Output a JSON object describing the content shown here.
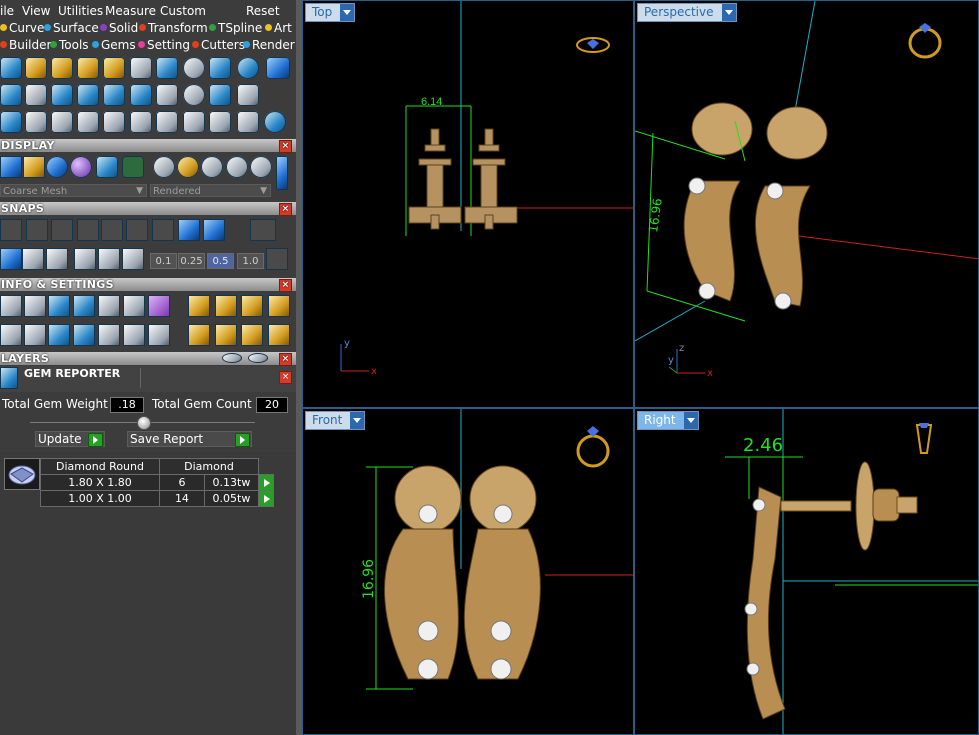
{
  "menu": [
    "ile",
    "View",
    "Utilities",
    "Measure",
    "Custom",
    "Reset"
  ],
  "tabs_row1": [
    {
      "label": "Curve",
      "color": "#f0c020"
    },
    {
      "label": "Surface",
      "color": "#2ea0e0"
    },
    {
      "label": "Solid",
      "color": "#8a40c0"
    },
    {
      "label": "Transform",
      "color": "#e04020"
    },
    {
      "label": "TSpline",
      "color": "#30a040"
    },
    {
      "label": "Art",
      "color": "#f0c020"
    }
  ],
  "tabs_row2": [
    {
      "label": "Builder",
      "color": "#e04020"
    },
    {
      "label": "Tools",
      "color": "#30a040"
    },
    {
      "label": "Gems",
      "color": "#2ea0e0"
    },
    {
      "label": "Setting",
      "color": "#e040a0"
    },
    {
      "label": "Cutters",
      "color": "#e04020"
    },
    {
      "label": "Render",
      "color": "#2ea0e0"
    }
  ],
  "sections": {
    "display": "DISPLAY",
    "snaps": "SNAPS",
    "info": "INFO & SETTINGS",
    "layers": "LAYERS",
    "gem_reporter": "GEM REPORTER"
  },
  "display": {
    "mesh_mode": "Coarse Mesh",
    "render_mode": "Rendered"
  },
  "snaps": {
    "steps": [
      "0.1",
      "0.25",
      "0.5",
      "1.0"
    ],
    "selected": "0.5"
  },
  "gem_reporter": {
    "total_weight_label": "Total Gem Weight",
    "total_weight": ".18",
    "total_count_label": "Total Gem Count",
    "total_count": "20",
    "update_label": "Update",
    "save_label": "Save Report",
    "table_headers": [
      "Diamond Round",
      "Diamond"
    ],
    "rows": [
      {
        "size": "1.80 X 1.80",
        "count": "6",
        "weight": "0.13tw"
      },
      {
        "size": "1.00 X 1.00",
        "count": "14",
        "weight": "0.05tw"
      }
    ]
  },
  "viewports": {
    "top": {
      "label": "Top",
      "dimension": "6.14"
    },
    "perspective": {
      "label": "Perspective",
      "dimension": "16.96"
    },
    "front": {
      "label": "Front",
      "dimension": "16.96"
    },
    "right": {
      "label": "Right",
      "dimension": "2.46"
    }
  },
  "axes": {
    "x": "x",
    "y": "y",
    "z": "z"
  },
  "colors": {
    "accent_blue": "#7db6e8",
    "gold": "#c8a060",
    "dimension_green": "#20e020",
    "axis_red": "#cc2020",
    "guide_cyan": "#20b0c8"
  }
}
